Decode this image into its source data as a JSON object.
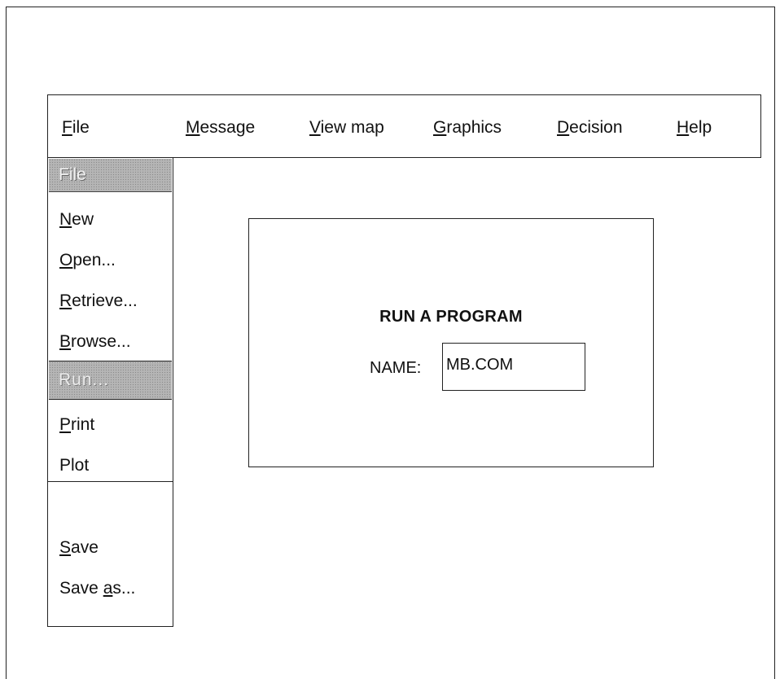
{
  "menubar": {
    "items": [
      {
        "pre": "",
        "key": "F",
        "post": "ile"
      },
      {
        "pre": "",
        "key": "M",
        "post": "essage"
      },
      {
        "pre": "",
        "key": "V",
        "post": "iew map"
      },
      {
        "pre": "",
        "key": "G",
        "post": "raphics"
      },
      {
        "pre": "",
        "key": "D",
        "post": "ecision"
      },
      {
        "pre": "",
        "key": "H",
        "post": "elp"
      }
    ]
  },
  "file_menu": {
    "header": "File",
    "items": [
      {
        "pre": "",
        "key": "N",
        "post": "ew"
      },
      {
        "pre": "",
        "key": "O",
        "post": "pen..."
      },
      {
        "pre": "",
        "key": "R",
        "post": "etrieve..."
      },
      {
        "pre": "",
        "key": "B",
        "post": "rowse..."
      }
    ],
    "run": "Run...",
    "items2": [
      {
        "pre": "",
        "key": "P",
        "post": "rint"
      },
      {
        "pre": "",
        "key": "",
        "post": "Plot"
      }
    ],
    "items3": [
      {
        "pre": "",
        "key": "S",
        "post": "ave"
      },
      {
        "pre": "Save ",
        "key": "a",
        "post": "s..."
      }
    ]
  },
  "dialog": {
    "title": "RUN A PROGRAM",
    "name_label": "NAME:",
    "name_value": "MB.COM"
  }
}
